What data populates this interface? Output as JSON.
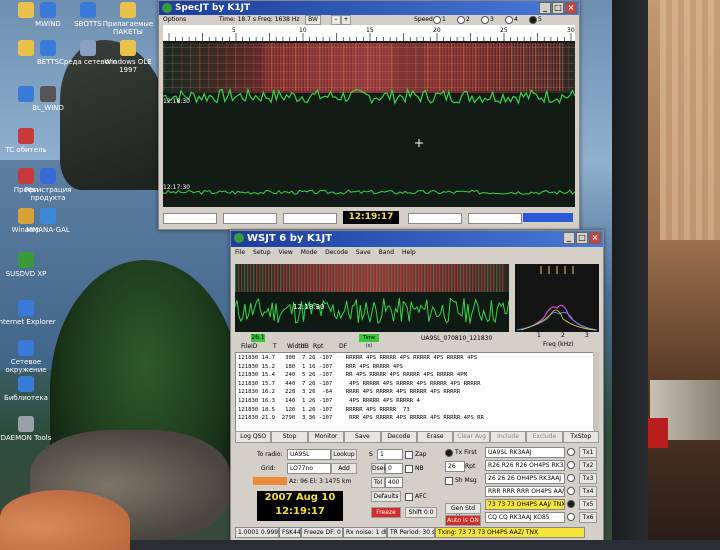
{
  "desktop": {
    "icons": [
      {
        "label": "",
        "color": "#e8c24a"
      },
      {
        "label": "MWIND",
        "color": "#3a7ad8"
      },
      {
        "label": "SBOTTS",
        "color": "#3a7ad8"
      },
      {
        "label": "Прилагаемые ПАКЕТЫ",
        "color": "#e8c24a"
      },
      {
        "label": "",
        "color": "#e8c24a"
      },
      {
        "label": "BETTS",
        "color": "#3a7ad8"
      },
      {
        "label": "Среда сетевого",
        "color": "#8aa0c0"
      },
      {
        "label": "Windows OLE 1997",
        "color": "#e8c24a"
      },
      {
        "label": "",
        "color": "#3a7ad8"
      },
      {
        "label": "BL_WIND",
        "color": "#555"
      },
      {
        "label": "TC обитель",
        "color": "#c83a3a"
      },
      {
        "label": "Профи",
        "color": "#c83a3a"
      },
      {
        "label": "Регистрация продукта",
        "color": "#3a6ad8"
      },
      {
        "label": "Winamp",
        "color": "#d8a23a"
      },
      {
        "label": "MMANA-GAL",
        "color": "#3a8ad8"
      },
      {
        "label": "SUSDVD XP",
        "color": "#3a9a3a"
      },
      {
        "label": "Internet Explorer",
        "color": "#3a7ad8"
      },
      {
        "label": "Сетевое окружение",
        "color": "#3a7ad8"
      },
      {
        "label": "Библиотека",
        "color": "#3a7ad8"
      },
      {
        "label": "DAEMON Tools",
        "color": "#9aa0a8"
      }
    ]
  },
  "specjt": {
    "title": "SpecJT     by K1JT",
    "options_label": "Options",
    "time_freq": "Time: 18.7 s  Freq: 1638 Hz",
    "bw_button": "BW",
    "speed_label": "Speed",
    "speed_options": [
      "1",
      "2",
      "3",
      "4",
      "5"
    ],
    "scale_ticks": [
      "5",
      "10",
      "15",
      "20",
      "25",
      "30"
    ],
    "time_markers": [
      "12:18:30",
      "12:17:30"
    ],
    "clock": "12:19:17"
  },
  "wsjt": {
    "title": "WSJT 6     by K1JT",
    "menu": [
      "File",
      "Setup",
      "View",
      "Mode",
      "Decode",
      "Save",
      "Band",
      "Help"
    ],
    "spectrum_time": "12:18:30",
    "freq_axis_label": "Freq (kHz)",
    "freq_ticks": [
      "1",
      "2",
      "3"
    ],
    "file_info": "UA9SL_070810_121830",
    "status_values": {
      "db": "26.1",
      "time_status": "Time (s)"
    },
    "col_headers": [
      "FileID",
      "T",
      "Width",
      "dB",
      "Rpt",
      "DF"
    ],
    "decode_lines": [
      "121830 14.7   300  7 26 -107    RRRRR 4PS RRRRR 4PS RRRRR 4PS RRRRR 4PS",
      "121830 15.2   180  1 16 -107    RRR 4PS RRRRR 4PS",
      "121830 15.4   240  5 26 -107    RR 4PS RRRRR 4PS RRRRR 4PS RRRRR 4PM",
      "121830 15.7   440  7 26 -107     4PS RRRRR 4PS RRRRR 4PS RRRRR 4PS RRRRR",
      "121830 16.2   220  3 26  -64    RRRR 4PS RRRRR 4PS RRRRR 4PS RRRRR",
      "121830 16.3   140  1 26 -107     4PS RRRRR 4PS RRRRR 4",
      "121830 18.5   120  1 26 -107    RRRRR 4PS RRRRR  73",
      "121830 21.9  2790  3 36 -107     RRR 4PS RRRRR 4PS RRRRR 4PS RRRRR 4PS RR"
    ],
    "buttons": [
      "Log QSO",
      "Stop",
      "Monitor",
      "Save",
      "Decode",
      "Erase",
      "Clear Avg",
      "Include",
      "Exclude",
      "TxStop"
    ],
    "to_radio_label": "To radio:",
    "to_radio_value": "UA9SL",
    "lookup_btn": "Lookup",
    "grid_label": "Grid:",
    "grid_value": "LO77no",
    "add_btn": "Add",
    "az_info": "Az: 96  El: 3    1475 km",
    "date": "2007 Aug 10",
    "time": "12:19:17",
    "ctrl_values": {
      "s": "1",
      "dsec": "0",
      "tol": "400"
    },
    "ctrl_labels": {
      "s": "S",
      "dsec": "Dsec",
      "tol": "Tol",
      "zap": "Zap",
      "nb": "NB",
      "freeze": "Freeze",
      "afc": "AFC",
      "defaults": "Defaults",
      "shift": "Shift 0.0",
      "tx_first": "Tx First",
      "sh_msg": "Sh Msg",
      "rpt": "Rpt",
      "gen_std": "Gen Std Msgs",
      "auto": "Auto is ON"
    },
    "rpt_value": "26",
    "tx_msgs": [
      "UA9SL RK3AAJ",
      "R26 R26 R26 OH4PS RK3AAZ",
      "26 26 26 OH4PS RK3AAJ",
      "RRR RRR RRR OH4PS AA/J",
      "73 73 73 OH4PS AAJ/ TNX",
      "CQ CQ RK3AAJ KO85"
    ],
    "tx_labels": [
      "Tx1",
      "Tx2",
      "Tx3",
      "Tx4",
      "Tx5",
      "Tx6"
    ],
    "statusbar": [
      "1.0001  0.9997",
      "FSK441",
      "Freeze DF:  0",
      "Rx noise:  1 dB",
      "TR Period: 30 s",
      "Txing: 73 73 73 OH4PS  AAZ/ TNX"
    ]
  },
  "colors": {
    "title_bar": "#1a3d9c",
    "waterfall_bg": "#111a16",
    "trace": "#34d64a",
    "green_box": "#3ac43a",
    "red_btn": "#d42a2a",
    "yellow_bg": "#f5e53a",
    "clock_bg": "#000000",
    "clock_fg": "#f5e03a"
  }
}
